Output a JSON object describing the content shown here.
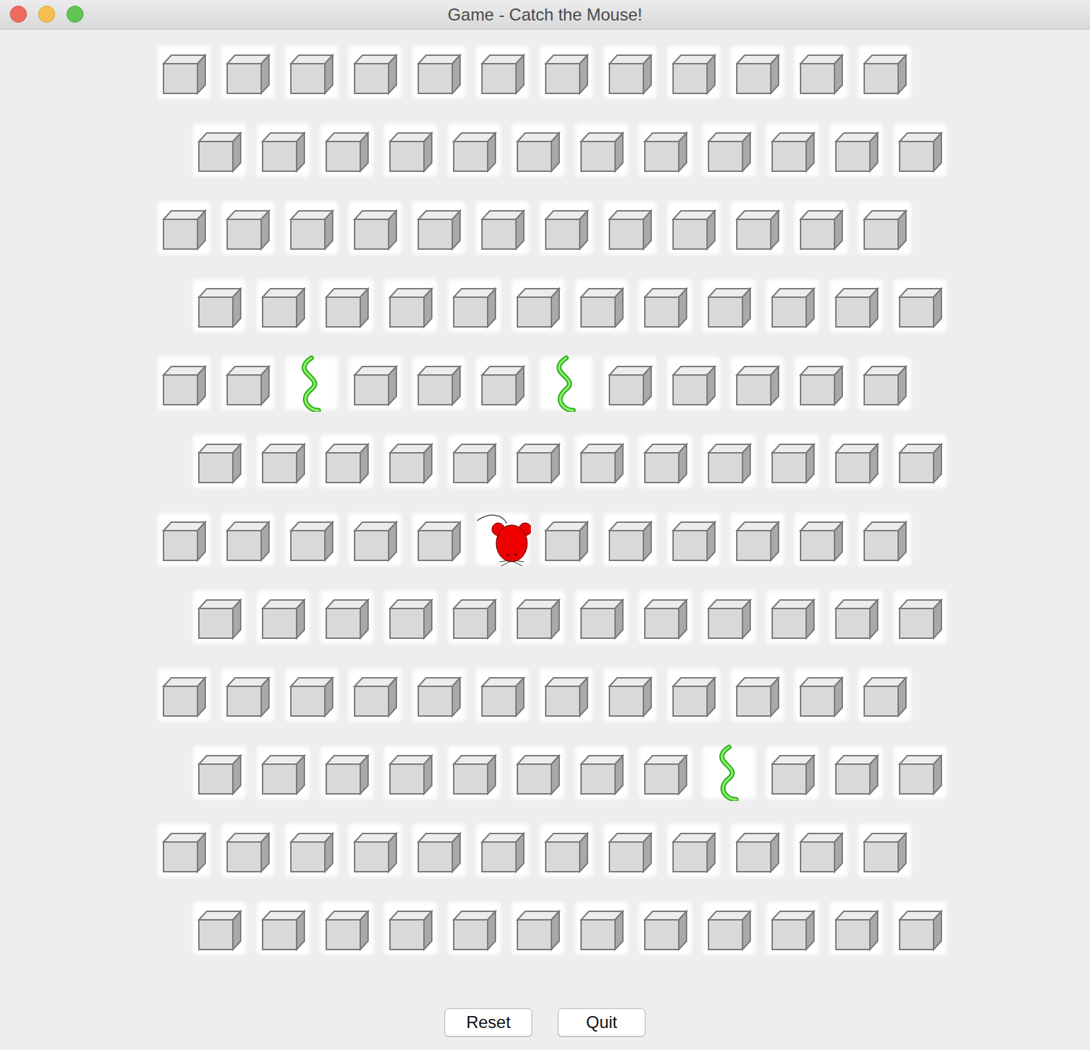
{
  "window": {
    "title": "Game - Catch the Mouse!"
  },
  "board": {
    "rows": [
      [
        "block",
        "block",
        "block",
        "block",
        "block",
        "block",
        "block",
        "block",
        "block",
        "block",
        "block",
        "block"
      ],
      [
        "block",
        "block",
        "block",
        "block",
        "block",
        "block",
        "block",
        "block",
        "block",
        "block",
        "block",
        "block"
      ],
      [
        "block",
        "block",
        "block",
        "block",
        "block",
        "block",
        "block",
        "block",
        "block",
        "block",
        "block",
        "block"
      ],
      [
        "block",
        "block",
        "block",
        "block",
        "block",
        "block",
        "block",
        "block",
        "block",
        "block",
        "block",
        "block"
      ],
      [
        "block",
        "block",
        "snake",
        "block",
        "block",
        "block",
        "snake",
        "block",
        "block",
        "block",
        "block",
        "block"
      ],
      [
        "block",
        "block",
        "block",
        "block",
        "block",
        "block",
        "block",
        "block",
        "block",
        "block",
        "block",
        "block"
      ],
      [
        "block",
        "block",
        "block",
        "block",
        "block",
        "mouse",
        "block",
        "block",
        "block",
        "block",
        "block",
        "block"
      ],
      [
        "block",
        "block",
        "block",
        "block",
        "block",
        "block",
        "block",
        "block",
        "block",
        "block",
        "block",
        "block"
      ],
      [
        "block",
        "block",
        "block",
        "block",
        "block",
        "block",
        "block",
        "block",
        "block",
        "block",
        "block",
        "block"
      ],
      [
        "block",
        "block",
        "block",
        "block",
        "block",
        "block",
        "block",
        "block",
        "snake",
        "block",
        "block",
        "block"
      ],
      [
        "block",
        "block",
        "block",
        "block",
        "block",
        "block",
        "block",
        "block",
        "block",
        "block",
        "block",
        "block"
      ],
      [
        "block",
        "block",
        "block",
        "block",
        "block",
        "block",
        "block",
        "block",
        "block",
        "block",
        "block",
        "block"
      ]
    ]
  },
  "buttons": [
    "Reset",
    "Quit"
  ]
}
